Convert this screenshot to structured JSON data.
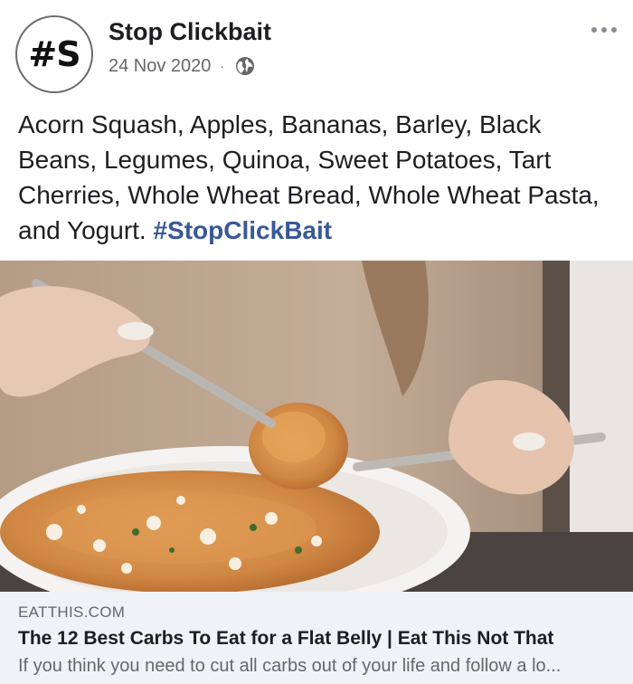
{
  "post": {
    "avatar_text": "#S",
    "page_name": "Stop Clickbait",
    "date": "24 Nov 2020",
    "separator": "·",
    "privacy_icon": "globe-icon",
    "menu_icon": "more-dots-icon",
    "text": "Acorn Squash, Apples, Bananas, Barley, Black Beans, Legumes, Quinoa, Sweet Potatoes, Tart Cherries, Whole Wheat Bread, Whole Wheat Pasta, and Yogurt.",
    "hashtag": "#StopClickBait"
  },
  "link_preview": {
    "domain": "EATTHIS.COM",
    "title": "The 12 Best Carbs To Eat for a Flat Belly | Eat This Not That",
    "description": "If you think you need to cut all carbs out of your life and follow a lo..."
  },
  "colors": {
    "hashtag": "#385898",
    "secondary_text": "#65676b",
    "preview_background": "#f0f2f5"
  }
}
